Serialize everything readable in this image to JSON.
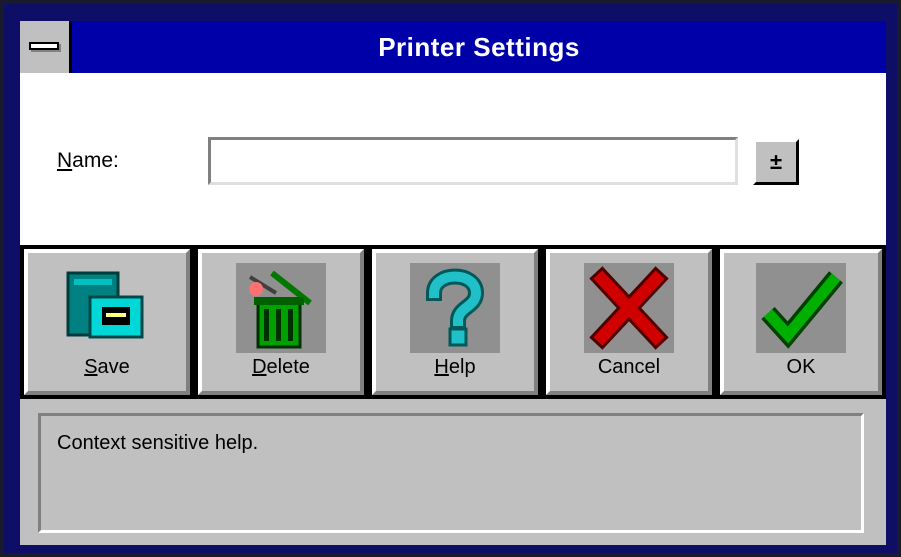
{
  "window": {
    "title": "Printer Settings"
  },
  "form": {
    "name_label_accel": "N",
    "name_label_rest": "ame:",
    "name_value": "",
    "spin_glyph": "±"
  },
  "toolbar": {
    "buttons": [
      {
        "accel": "S",
        "rest": "ave",
        "icon": "save-icon"
      },
      {
        "accel": "D",
        "rest": "elete",
        "icon": "delete-trash-icon"
      },
      {
        "accel": "H",
        "rest": "elp",
        "icon": "help-question-icon"
      },
      {
        "accel": "",
        "rest": "Cancel",
        "icon": "cancel-x-icon"
      },
      {
        "accel": "",
        "rest": "OK",
        "icon": "ok-checkmark-icon"
      }
    ]
  },
  "status": {
    "text": "Context sensitive help."
  },
  "colors": {
    "titlebar": "#0000a8",
    "face": "#c0c0c0",
    "cancel_red": "#c00000",
    "ok_green": "#00a000",
    "help_teal": "#00a8a8"
  }
}
